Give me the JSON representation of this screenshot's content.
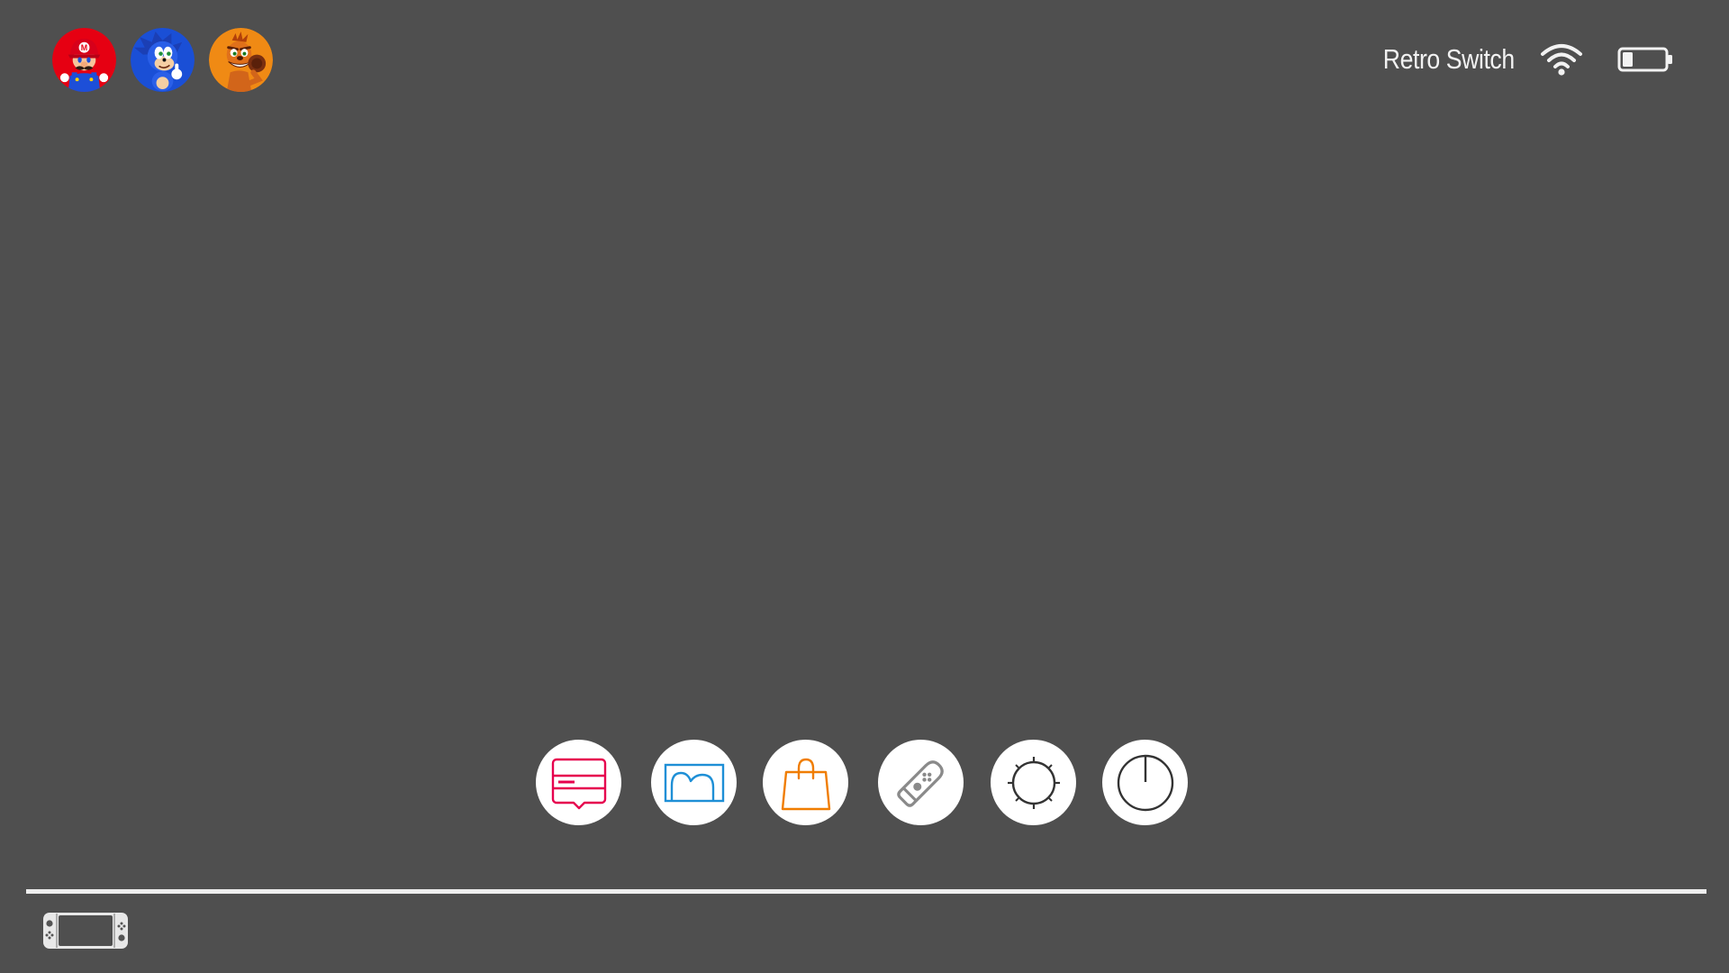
{
  "status_bar": {
    "console_name": "Retro Switch",
    "wifi_icon": "wifi-icon",
    "battery_icon": "battery-low-icon",
    "battery_level": 0.25
  },
  "users": [
    {
      "icon": "mario-avatar",
      "color": "#e60012"
    },
    {
      "icon": "sonic-avatar",
      "color": "#1a4fd6"
    },
    {
      "icon": "crash-avatar",
      "color": "#f08a14"
    }
  ],
  "dock": [
    {
      "icon": "news-icon",
      "color": "#e6004e"
    },
    {
      "icon": "album-icon",
      "color": "#1e8fd6"
    },
    {
      "icon": "eshop-icon",
      "color": "#f07d00"
    },
    {
      "icon": "controllers-icon",
      "color": "#8a8a8a"
    },
    {
      "icon": "settings-icon",
      "color": "#333333"
    },
    {
      "icon": "power-icon",
      "color": "#333333"
    }
  ],
  "footer": {
    "mode_icon": "handheld-mode-icon"
  },
  "colors": {
    "background": "#4f4f4f",
    "foreground": "#f2f2f2"
  }
}
